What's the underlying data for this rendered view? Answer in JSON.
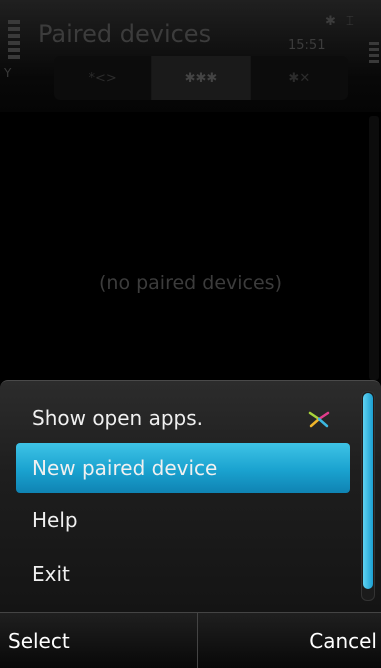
{
  "title_bar": {
    "title": "Paired devices",
    "clock": "15:51",
    "signal_icon": "signal-strength-icon",
    "battery_icon": "battery-level-icon",
    "bluetooth_status_icon": "bluetooth-status-icon"
  },
  "tabs": [
    {
      "icon": "bluetooth-device-tab-icon",
      "label": "*<>"
    },
    {
      "icon": "bluetooth-paired-tab-icon",
      "label": "✱✱✱"
    },
    {
      "icon": "bluetooth-blocked-tab-icon",
      "label": "✱✕"
    }
  ],
  "content": {
    "empty_message": "(no paired devices)"
  },
  "menu": {
    "items": [
      {
        "label": "Show open apps.",
        "icon": "task-switcher-icon"
      },
      {
        "label": "New paired device"
      },
      {
        "label": "Help"
      },
      {
        "label": "Exit"
      }
    ],
    "selected_index": 1
  },
  "softkeys": {
    "left": "Select",
    "right": "Cancel"
  },
  "colors": {
    "highlight": "#1aa2cf",
    "background": "#000000",
    "dim_text": "#3c3c3c"
  }
}
